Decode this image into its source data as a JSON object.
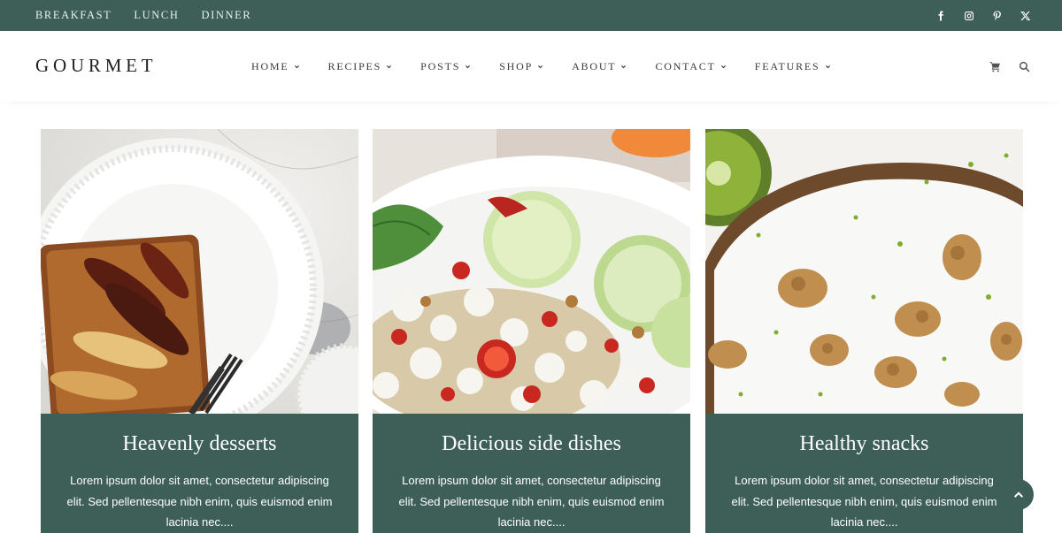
{
  "topbar": {
    "categories": [
      "BREAKFAST",
      "LUNCH",
      "DINNER"
    ],
    "social_icons": [
      "facebook-icon",
      "instagram-icon",
      "pinterest-icon",
      "x-icon"
    ],
    "background": "#3e5f58"
  },
  "header": {
    "logo": "GOURMET",
    "nav": [
      "HOME",
      "RECIPES",
      "POSTS",
      "SHOP",
      "ABOUT",
      "CONTACT",
      "FEATURES"
    ],
    "icons": [
      "cart-icon",
      "search-icon"
    ]
  },
  "cards": [
    {
      "title": "Heavenly desserts",
      "text": "Lorem ipsum dolor sit amet, consectetur adipiscing elit. Sed pellentesque nibh enim, quis euismod enim lacinia nec....",
      "image": "apple-tart-photo"
    },
    {
      "title": "Delicious side dishes",
      "text": "Lorem ipsum dolor sit amet, consectetur adipiscing elit. Sed pellentesque nibh enim, quis euismod enim lacinia nec....",
      "image": "salad-photo"
    },
    {
      "title": "Healthy snacks",
      "text": "Lorem ipsum dolor sit amet, consectetur adipiscing elit. Sed pellentesque nibh enim, quis euismod enim lacinia nec....",
      "image": "walnut-toast-photo"
    }
  ],
  "accent_color": "#3e5f58",
  "scroll_top_icon": "chevron-up-icon"
}
